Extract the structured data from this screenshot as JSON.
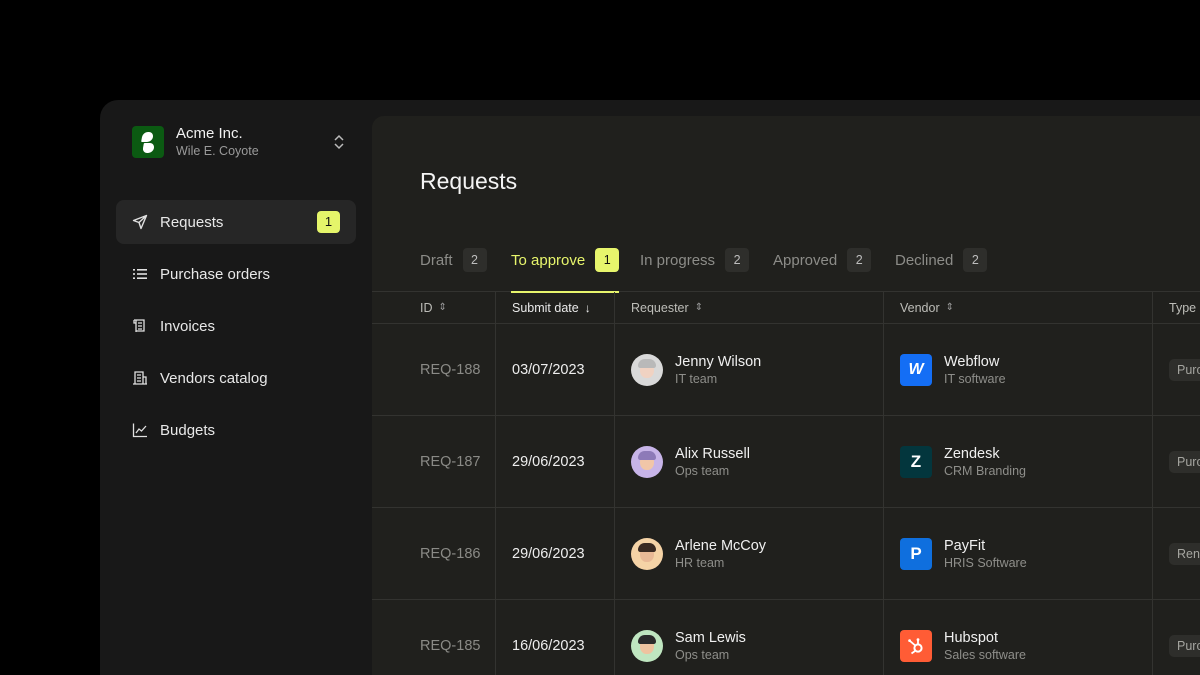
{
  "org": {
    "name": "Acme Inc.",
    "user": "Wile E. Coyote"
  },
  "nav": [
    {
      "label": "Requests",
      "badge": "1",
      "active": true
    },
    {
      "label": "Purchase orders"
    },
    {
      "label": "Invoices"
    },
    {
      "label": "Vendors catalog"
    },
    {
      "label": "Budgets"
    }
  ],
  "page": {
    "title": "Requests"
  },
  "tabs": [
    {
      "label": "Draft",
      "count": "2"
    },
    {
      "label": "To approve",
      "count": "1",
      "active": true
    },
    {
      "label": "In progress",
      "count": "2"
    },
    {
      "label": "Approved",
      "count": "2"
    },
    {
      "label": "Declined",
      "count": "2"
    }
  ],
  "columns": {
    "id": "ID",
    "date": "Submit date",
    "requester": "Requester",
    "vendor": "Vendor",
    "type": "Type"
  },
  "rows": [
    {
      "id": "REQ-188",
      "date": "03/07/2023",
      "requester": "Jenny Wilson",
      "team": "IT team",
      "vendor": "Webflow",
      "vendor_sub": "IT software",
      "type": "Purchase"
    },
    {
      "id": "REQ-187",
      "date": "29/06/2023",
      "requester": "Alix Russell",
      "team": "Ops team",
      "vendor": "Zendesk",
      "vendor_sub": "CRM Branding",
      "type": "Purchase"
    },
    {
      "id": "REQ-186",
      "date": "29/06/2023",
      "requester": "Arlene McCoy",
      "team": "HR team",
      "vendor": "PayFit",
      "vendor_sub": "HRIS Software",
      "type": "Renewal"
    },
    {
      "id": "REQ-185",
      "date": "16/06/2023",
      "requester": "Sam Lewis",
      "team": "Ops team",
      "vendor": "Hubspot",
      "vendor_sub": "Sales software",
      "type": "Purchase"
    }
  ],
  "colors": {
    "accent": "#e7f56c",
    "webflow": "#146ef5",
    "zendesk": "#03363d",
    "payfit": "#0f6fde",
    "hubspot": "#ff5c35"
  }
}
